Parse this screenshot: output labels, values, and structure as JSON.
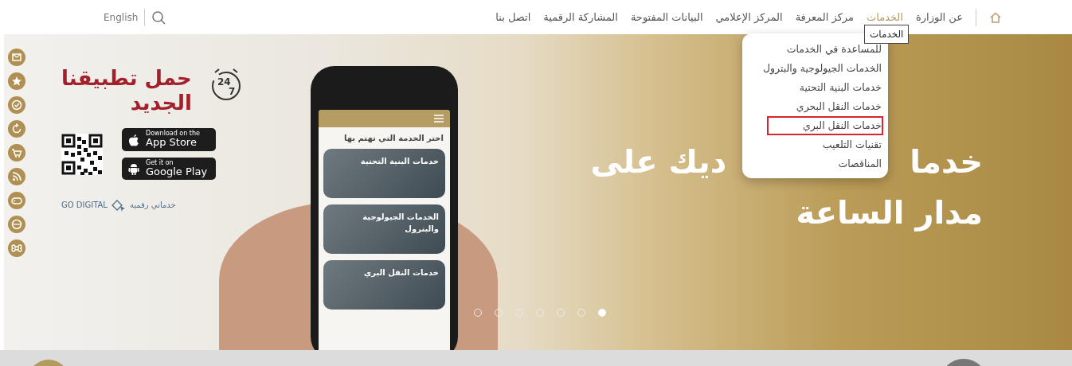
{
  "nav": {
    "items": [
      {
        "label": "عن الوزارة",
        "selected": false
      },
      {
        "label": "الخدمات",
        "selected": true
      },
      {
        "label": "مركز المعرفة",
        "selected": false
      },
      {
        "label": "المركز الإعلامي",
        "selected": false
      },
      {
        "label": "البيانات المفتوحة",
        "selected": false
      },
      {
        "label": "المشاركة الرقمية",
        "selected": false
      },
      {
        "label": "اتصل بنا",
        "selected": false
      }
    ],
    "language": "English"
  },
  "tooltip": "الخدمات",
  "dropdown": [
    {
      "label": "للمساعدة في الخدمات",
      "selected": false
    },
    {
      "label": "الخدمات الجيولوجية والبترول",
      "selected": false
    },
    {
      "label": "خدمات البنية التحتية",
      "selected": false
    },
    {
      "label": "خدمات النقل البحري",
      "selected": false
    },
    {
      "label": "خدمات النقل البري",
      "selected": true
    },
    {
      "label": "تقنيات التلعيب",
      "selected": false
    },
    {
      "label": "المناقصات",
      "selected": false
    }
  ],
  "banner": {
    "app_title": [
      "حمل تطبيقنا",
      "الجديد"
    ],
    "clock_digits": [
      "24",
      "7"
    ],
    "badges": [
      {
        "kind": "apple",
        "small": "Download on the",
        "big": "App Store"
      },
      {
        "kind": "android",
        "small": "Get it on",
        "big": "Google Play"
      }
    ],
    "go_digital": "GO DIGITAL",
    "go_digital_ar": "خدماتي رقمية",
    "phone": {
      "heading": "اختر الخدمة التي تهتم بها",
      "cards": [
        "خدمات البنية التحتية",
        "الخدمات الجيولوجية والبترول",
        "خدمات النقل البري"
      ]
    },
    "headline_line_1": [
      "خدما",
      "ديك على"
    ],
    "headline_line_2": "مدار الساعة"
  },
  "carousel_dots": [
    {
      "selected": false
    },
    {
      "selected": false
    },
    {
      "selected": false
    },
    {
      "selected": false
    },
    {
      "selected": false
    },
    {
      "selected": false
    },
    {
      "selected": true
    }
  ]
}
